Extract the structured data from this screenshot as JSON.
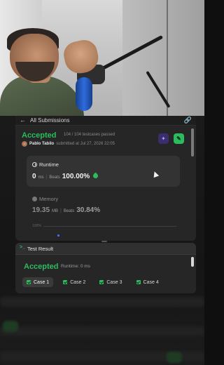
{
  "header": {
    "back_label": "All Submissions",
    "back_icon": "arrow-left-icon",
    "link_icon": "link-icon"
  },
  "submission": {
    "status": "Accepted",
    "testcases": "104 / 104 testcases passed",
    "user_name": "Pablo Tabilo",
    "submitted_text": "submitted at Jul 27, 2026 22:05",
    "ai_button_icon": "sparkle-icon",
    "edit_button_icon": "note-icon",
    "accent_color": "#2cbb5d"
  },
  "runtime": {
    "label": "Runtime",
    "value": "0",
    "unit": "ms",
    "beats_label": "Beats",
    "beats_value": "100.00%"
  },
  "memory": {
    "label": "Memory",
    "value": "19.35",
    "unit": "MB",
    "beats_label": "Beats",
    "beats_value": "30.84%",
    "chart_tick": "100%"
  },
  "test_result": {
    "title": "Test Result",
    "status": "Accepted",
    "runtime_text": "Runtime: 0 ms",
    "cases": [
      {
        "label": "Case 1",
        "active": true
      },
      {
        "label": "Case 2",
        "active": false
      },
      {
        "label": "Case 3",
        "active": false
      },
      {
        "label": "Case 4",
        "active": false
      }
    ]
  }
}
